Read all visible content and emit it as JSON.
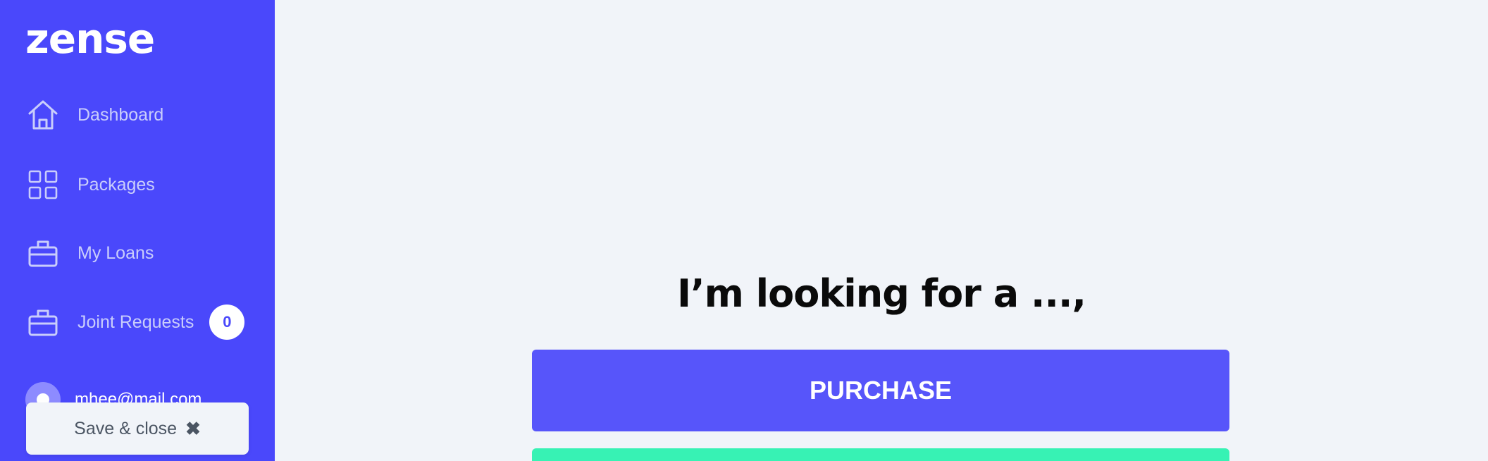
{
  "sidebar": {
    "logo": "zense",
    "items": [
      {
        "label": "Dashboard",
        "icon": "home-icon"
      },
      {
        "label": "Packages",
        "icon": "grid-icon"
      },
      {
        "label": "My Loans",
        "icon": "briefcase-icon"
      },
      {
        "label": "Joint Requests",
        "icon": "briefcase-icon",
        "badge": "0"
      }
    ],
    "user": {
      "email": "mhee@mail.com"
    },
    "save_close_label": "Save & close",
    "save_close_icon": "close-icon"
  },
  "main": {
    "heading": "I’m looking for a ...,",
    "options": [
      {
        "label": "PURCHASE",
        "color": "#5755fa"
      },
      {
        "label": "",
        "color": "#37f2b4"
      }
    ]
  },
  "colors": {
    "sidebar_bg": "#4a48fb",
    "page_bg": "#f1f4f9",
    "nav_text": "#c9cdfb"
  }
}
